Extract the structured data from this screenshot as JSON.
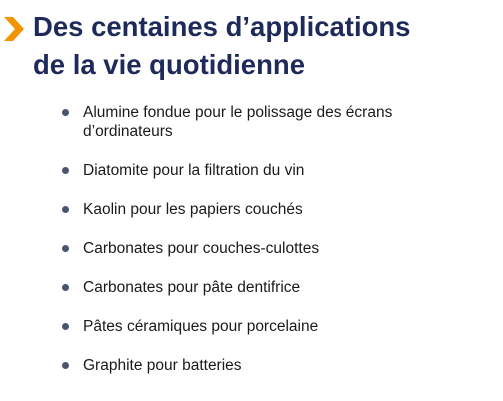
{
  "slide": {
    "title_line1": "Des centaines d’applications",
    "title_line2": "de la vie quotidienne",
    "bullets": [
      "Alumine fondue pour le polissage des écrans d’ordinateurs",
      "Diatomite pour la filtration du vin",
      "Kaolin pour les papiers couchés",
      "Carbonates pour couches-culottes",
      "Carbonates pour pâte dentifrice",
      "Pâtes céramiques pour porcelaine",
      "Graphite pour batteries"
    ]
  },
  "colors": {
    "accent": "#f29400",
    "title": "#1d2a5a",
    "bullet_dot": "#4a5470",
    "text": "#1a1a1a"
  },
  "icons": {
    "title_marker": "chevron-right-icon"
  }
}
